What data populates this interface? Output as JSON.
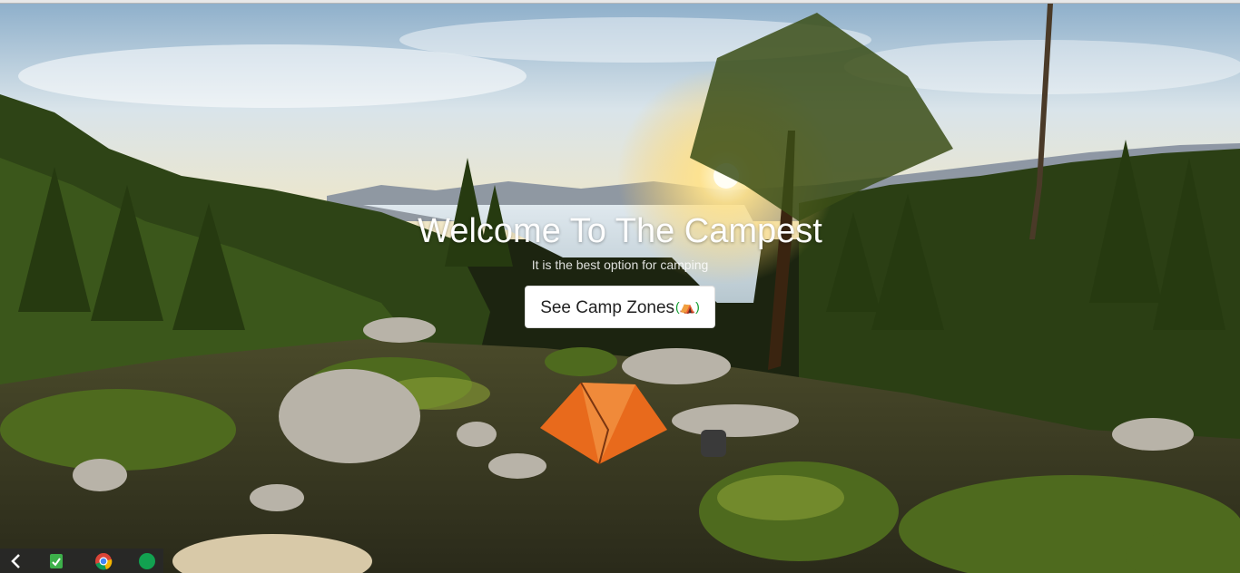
{
  "hero": {
    "title": "Welcome To The Campest",
    "subtitle": "It is the best option for camping",
    "cta_label": "See Camp Zones",
    "cta_icon": "tent-icon"
  },
  "taskbar": {
    "items": [
      "back-arrow-icon",
      "files-app-icon",
      "chrome-icon",
      "green-app-icon"
    ]
  },
  "colors": {
    "sky": "#d9e6ee",
    "forest": "#2f3e16",
    "sun": "#fff3b0",
    "tent": "#e86a1c",
    "cta_accent": "#0a9a2a"
  }
}
